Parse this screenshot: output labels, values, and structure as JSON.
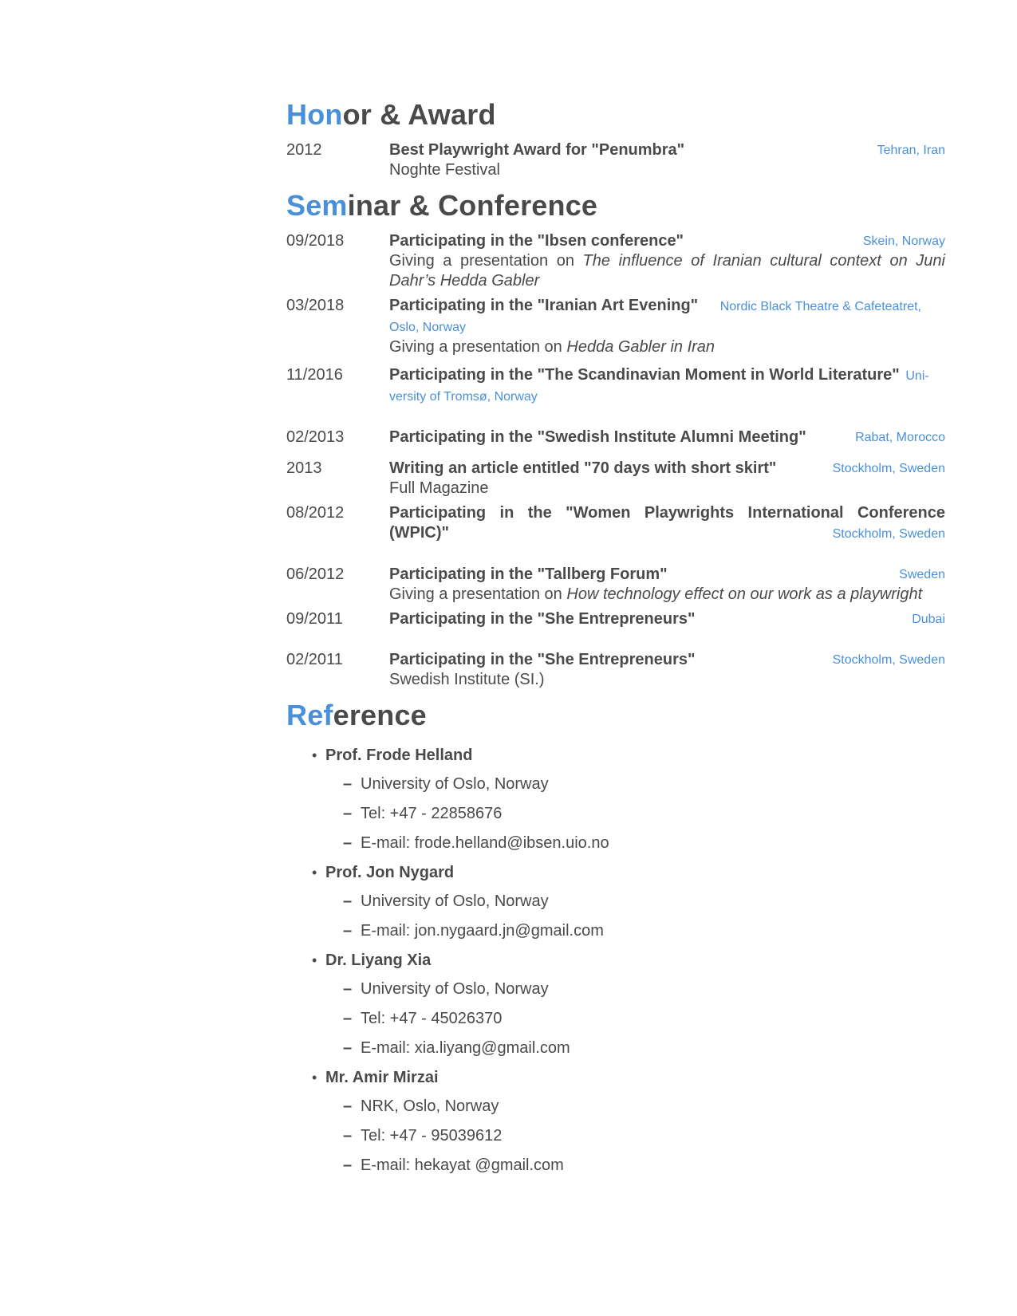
{
  "honor": {
    "heading_accent": "Hon",
    "heading_rest": "or & Award",
    "entries": [
      {
        "date": "2012",
        "title": "Best Playwright Award for \"Penumbra\"",
        "location": "Tehran, Iran",
        "sub": "Noghte Festival"
      }
    ]
  },
  "seminar": {
    "heading_accent": "Sem",
    "heading_rest": "inar & Conference",
    "entries": [
      {
        "date": "09/2018",
        "title": "Participating in the \"Ibsen conference\"",
        "location": "Skein, Norway",
        "sub_prefix": "Giving a presentation on ",
        "sub_italic": "The influence of Iranian cultural context on Juni Dahr’s Hedda Gabler"
      },
      {
        "date": "03/2018",
        "title": "Participating in the \"Iranian Art Evening\"",
        "location": "Nordic Black Theatre & Cafeteatret, Oslo, Norway",
        "sub_prefix": "Giving a presentation on ",
        "sub_italic": "Hedda Gabler in Iran"
      },
      {
        "date": "11/2016",
        "title": "Participating in the \"The Scandinavian Moment in World Literature\"",
        "location": "Uni- versity of Tromsø, Norway"
      },
      {
        "date": "02/2013",
        "title": "Participating in the \"Swedish Institute Alumni Meeting\"",
        "location": "Rabat, Morocco"
      },
      {
        "date": "2013",
        "title": "Writing an article entitled \"70 days with short skirt\"",
        "location": "Stockholm, Sweden",
        "sub": "Full Magazine"
      },
      {
        "date": "08/2012",
        "title": "Participating in the \"Women Playwrights International Conference (WPIC)\"",
        "location": "Stockholm, Sweden"
      },
      {
        "date": "06/2012",
        "title": "Participating in the \"Tallberg Forum\"",
        "location": "Sweden",
        "sub_prefix": "Giving a presentation on ",
        "sub_italic": "How technology effect on our work as a playwright"
      },
      {
        "date": "09/2011",
        "title": "Participating in the \"She Entrepreneurs\"",
        "location": "Dubai"
      },
      {
        "date": "02/2011",
        "title": "Participating in the \"She Entrepreneurs\"",
        "location": "Stockholm, Sweden",
        "sub": "Swedish Institute (SI.)"
      }
    ]
  },
  "reference": {
    "heading_accent": "Ref",
    "heading_rest": "erence",
    "bullet": "•",
    "dash": "–",
    "people": [
      {
        "name": "Prof. Frode Helland",
        "details": [
          "University of Oslo, Norway",
          "Tel: +47 - 22858676",
          "E-mail: frode.helland@ibsen.uio.no"
        ]
      },
      {
        "name": "Prof. Jon Nygard",
        "details": [
          "University of Oslo, Norway",
          "E-mail: jon.nygaard.jn@gmail.com"
        ]
      },
      {
        "name": "Dr. Liyang Xia",
        "details": [
          "University of Oslo, Norway",
          "Tel: +47 - 45026370",
          "E-mail: xia.liyang@gmail.com"
        ]
      },
      {
        "name": "Mr. Amir Mirzai",
        "details": [
          "NRK, Oslo, Norway",
          "Tel: +47 - 95039612",
          "E-mail: hekayat @gmail.com"
        ]
      }
    ]
  },
  "colors": {
    "accent": "#4a90d9",
    "text": "#4a4a4a"
  }
}
